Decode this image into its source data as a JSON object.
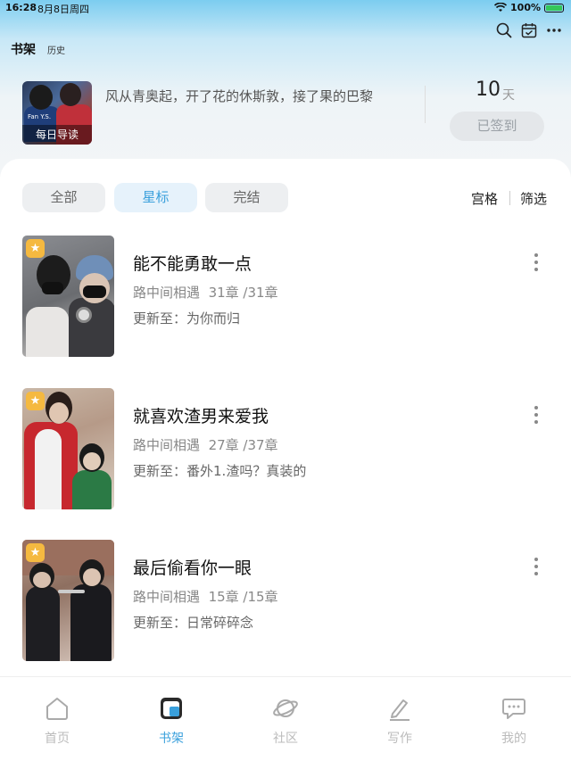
{
  "status_bar": {
    "time": "16:28",
    "date": "8月8日周四",
    "battery": "100%"
  },
  "header": {
    "tab_bookshelf": "书架",
    "tab_history": "历史",
    "icons": [
      "search-icon",
      "calendar-check-icon",
      "more-horizontal-icon"
    ]
  },
  "daily_guide": {
    "label": "每日导读",
    "text": "风从青奥起，开了花的休斯敦，接了果的巴黎",
    "cover_jersey_text": "Fan Y.S."
  },
  "checkin": {
    "days": "10",
    "unit": "天",
    "button_label": "已签到"
  },
  "filters": {
    "all": "全部",
    "starred": "星标",
    "finished": "完结",
    "active": "星标"
  },
  "view_options": {
    "grid": "宫格",
    "filter": "筛选"
  },
  "books": [
    {
      "title": "能不能勇敢一点",
      "author": "路中间相遇",
      "progress": "31章 /31章",
      "update_prefix": "更新至：",
      "update_chapter": "为你而归",
      "starred": true
    },
    {
      "title": "就喜欢渣男来爱我",
      "author": "路中间相遇",
      "progress": "27章 /37章",
      "update_prefix": "更新至：",
      "update_chapter": "番外1.渣吗？真装的",
      "starred": true
    },
    {
      "title": "最后偷看你一眼",
      "author": "路中间相遇",
      "progress": "15章 /15章",
      "update_prefix": "更新至：",
      "update_chapter": "日常碎碎念",
      "starred": true
    }
  ],
  "bottom_nav": [
    {
      "label": "首页",
      "icon": "home-icon"
    },
    {
      "label": "书架",
      "icon": "bookshelf-icon",
      "active": true
    },
    {
      "label": "社区",
      "icon": "planet-icon"
    },
    {
      "label": "写作",
      "icon": "pen-icon"
    },
    {
      "label": "我的",
      "icon": "chat-bubble-icon"
    }
  ],
  "colors": {
    "accent": "#3aa0dc",
    "star": "#f5b940"
  }
}
